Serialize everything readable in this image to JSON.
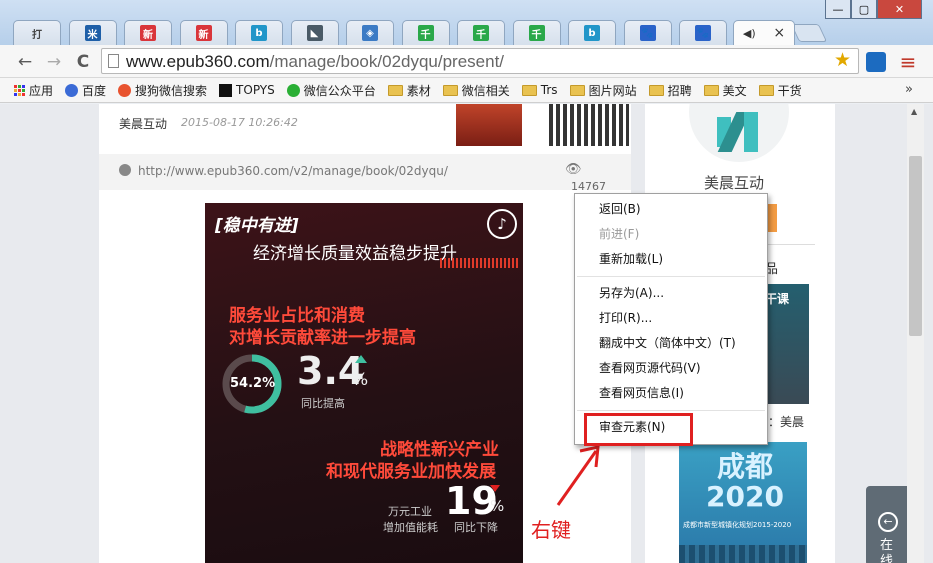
{
  "tabs": [
    {
      "label": "打",
      "fav_color": "#ffffff"
    },
    {
      "label": "",
      "fav_color": "#1e5fa8",
      "fav_glyph": "米"
    },
    {
      "label": "",
      "fav_color": "#d9353a",
      "fav_glyph": "新"
    },
    {
      "label": "",
      "fav_color": "#d9353a",
      "fav_glyph": "新"
    },
    {
      "label": "",
      "fav_color": "#2196c9",
      "fav_glyph": "b"
    },
    {
      "label": "",
      "fav_color": "#4a5a66",
      "fav_glyph": "◣"
    },
    {
      "label": "",
      "fav_color": "#3b7bc5",
      "fav_glyph": "◈"
    },
    {
      "label": "",
      "fav_color": "#2aa84a",
      "fav_glyph": "千"
    },
    {
      "label": "",
      "fav_color": "#2aa84a",
      "fav_glyph": "千"
    },
    {
      "label": "",
      "fav_color": "#2aa84a",
      "fav_glyph": "千"
    },
    {
      "label": "",
      "fav_color": "#2196c9",
      "fav_glyph": "b"
    },
    {
      "label": "",
      "fav_color": "#2a63c9",
      "fav_glyph": "🐾"
    },
    {
      "label": "",
      "fav_color": "#2a63c9",
      "fav_glyph": "🐾"
    }
  ],
  "active_tab": {
    "audio_icon": "speaker-icon",
    "close": "×"
  },
  "toolbar": {
    "back": "←",
    "forward": "→",
    "reload": "C",
    "url_host": "www.epub360.com",
    "url_path": "/manage/book/02dyqu/present/",
    "star": "☆",
    "menu": "≡"
  },
  "bookmarks": {
    "apps": "应用",
    "items": [
      "百度",
      "搜狗微信搜索",
      "TOPYS",
      "微信公众平台",
      "素材",
      "微信相关",
      "Trs",
      "图片网站",
      "招聘",
      "美文",
      "干货"
    ],
    "more": "»"
  },
  "article": {
    "author": "美晨互动",
    "date": "2015-08-17 10:26:42",
    "link": "http://www.epub360.com/v2/manage/book/02dyqu/",
    "views": "14767"
  },
  "poster": {
    "tag": "[稳中有进]",
    "title": "经济增长质量效益稳步提升",
    "h1_line1": "服务业占比和消费",
    "h1_line2": "对增长贡献率进一步提高",
    "donut_value": "54.2%",
    "donut_fraction": 0.542,
    "stat1_value": "3.4",
    "stat1_unit": "%",
    "stat1_desc": "同比提高",
    "h2_line1": "战略性新兴产业",
    "h2_line2": "和现代服务业加快发展",
    "stat2_label1": "万元工业",
    "stat2_label2": "增加值能耗",
    "stat2_value": "19",
    "stat2_unit": "%",
    "stat2_desc": "同比下降"
  },
  "annotation": {
    "label": "右键"
  },
  "sidebar": {
    "brand": "美晨互动",
    "frag1": "品",
    "frag2": "干课",
    "frag3": "：美晨",
    "city_title": "成都2020",
    "city_sub": "成都市新型城镇化规划2015-2020",
    "float_label": "在线"
  },
  "context_menu": {
    "items": [
      {
        "label": "返回(B)",
        "disabled": false
      },
      {
        "label": "前进(F)",
        "disabled": true
      },
      {
        "label": "重新加载(L)",
        "disabled": false
      },
      {
        "label": "另存为(A)...",
        "disabled": false
      },
      {
        "label": "打印(R)...",
        "disabled": false
      },
      {
        "label": "翻成中文（简体中文）(T)",
        "disabled": false
      },
      {
        "label": "查看网页源代码(V)",
        "disabled": false
      },
      {
        "label": "查看网页信息(I)",
        "disabled": false
      },
      {
        "label": "审查元素(N)",
        "disabled": false
      }
    ]
  },
  "colors": {
    "accent_red": "#e02020",
    "teal": "#3fbfa0",
    "poster_red": "#ff4a3a"
  }
}
